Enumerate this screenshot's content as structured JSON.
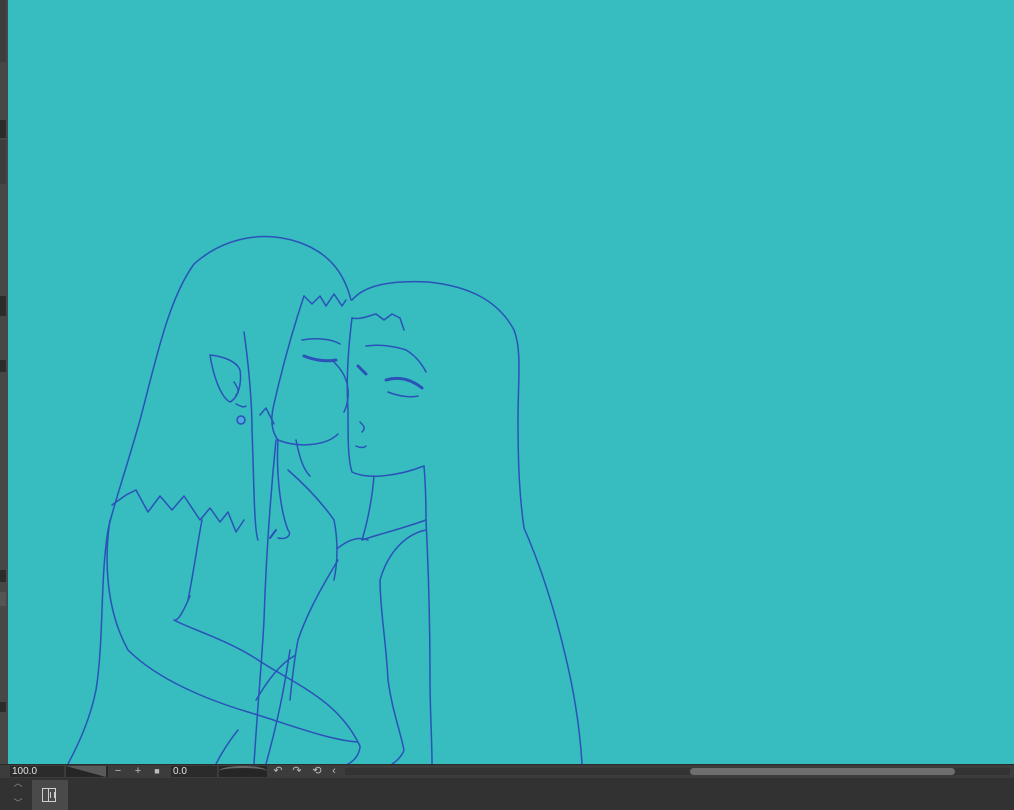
{
  "canvas": {
    "background": "#37bcbf",
    "line_color": "#2a52b8"
  },
  "statusbar": {
    "zoom_value": "100.0",
    "zoom_out_icon": "minus-icon",
    "zoom_in_icon": "plus-icon",
    "fit_icon": "square-icon",
    "angle_value": "0.0",
    "rotate_left_icon": "rotate-left-icon",
    "rotate_right_icon": "rotate-right-icon",
    "reset_rotation_icon": "reset-rotation-icon",
    "collapse_icon": "chevron-left-icon",
    "minus_glyph": "−",
    "plus_glyph": "+",
    "square_glyph": "■",
    "rotate_left_glyph": "↶",
    "rotate_right_glyph": "↷",
    "reset_glyph": "⟲",
    "chevron_glyph": "‹"
  },
  "bottom_panel": {
    "up_glyph": "︿",
    "down_glyph": "﹀"
  }
}
